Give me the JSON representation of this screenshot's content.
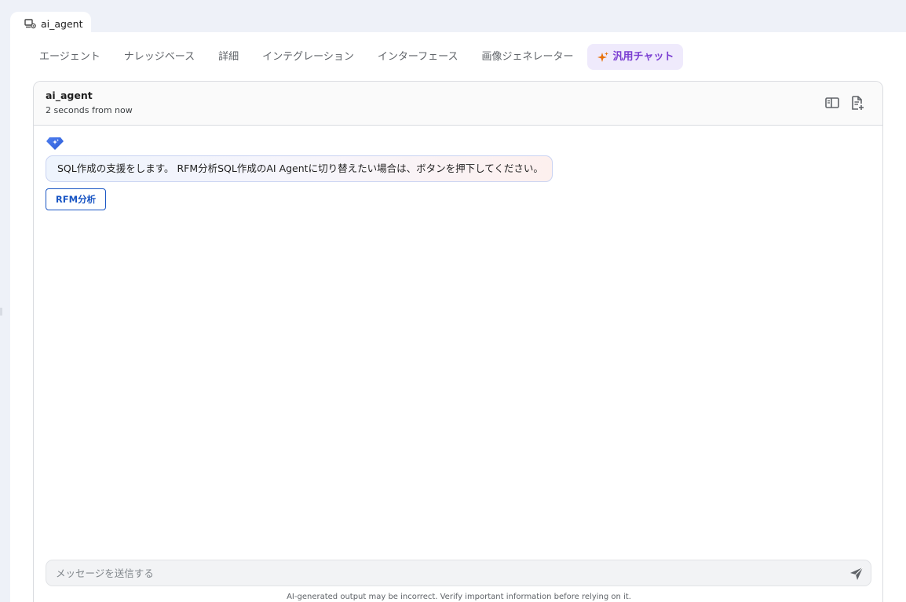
{
  "window": {
    "tab_title": "ai_agent",
    "tab_icon": "agent-tab-icon"
  },
  "nav": {
    "items": [
      {
        "label": "エージェント"
      },
      {
        "label": "ナレッジベース"
      },
      {
        "label": "詳細"
      },
      {
        "label": "インテグレーション"
      },
      {
        "label": "インターフェース"
      },
      {
        "label": "画像ジェネレーター"
      }
    ],
    "active": {
      "label": "汎用チャット",
      "icon": "sparkle-icon"
    }
  },
  "chat": {
    "agent_name": "ai_agent",
    "timestamp": "2 seconds from now",
    "header_icons": [
      "panel-toggle-icon",
      "add-document-icon"
    ],
    "message": "SQL作成の支援をします。 RFM分析SQL作成のAI Agentに切り替えたい場合は、ボタンを押下してください。",
    "suggestion_button": "RFM分析",
    "input_placeholder": "メッセージを送信する",
    "disclaimer": "AI-generated output may be incorrect. Verify important information before relying on it."
  },
  "colors": {
    "accent": "#7b3fd2",
    "accent_bg": "#efeafc",
    "sparkle": "#e8710a",
    "link_blue": "#1a56c4",
    "background": "#eef1f8"
  }
}
